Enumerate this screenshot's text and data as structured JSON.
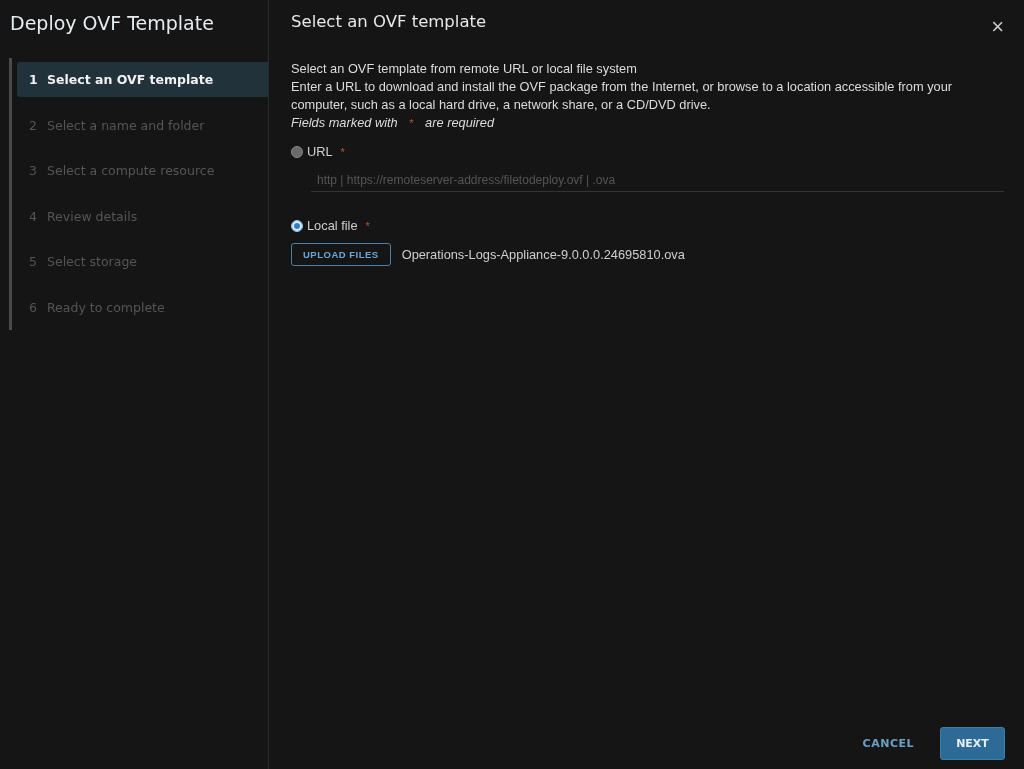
{
  "window": {
    "title": "Deploy OVF Template",
    "close": "×"
  },
  "steps": [
    {
      "number": "1",
      "label": "Select an OVF template",
      "selected": true,
      "disabled": false
    },
    {
      "number": "2",
      "label": "Select a name and folder",
      "selected": false,
      "disabled": true
    },
    {
      "number": "3",
      "label": "Select a compute resource",
      "selected": false,
      "disabled": true
    },
    {
      "number": "4",
      "label": "Review details",
      "selected": false,
      "disabled": true
    },
    {
      "number": "5",
      "label": "Select storage",
      "selected": false,
      "disabled": true
    },
    {
      "number": "6",
      "label": "Ready to complete",
      "selected": false,
      "disabled": true
    }
  ],
  "page": {
    "title": "Select an OVF template",
    "intro": "Select an OVF template from remote URL or local file system",
    "description": "Enter a URL to download and install the OVF package from the Internet, or browse to a location accessible from your computer, such as a local hard drive, a network share, or a CD/DVD drive.",
    "required_note": {
      "before": "Fields marked with",
      "mark": "*",
      "after": "are required"
    }
  },
  "sources": [
    {
      "kind": "url",
      "label": "URL",
      "required_mark": "*",
      "selected": false,
      "placeholder": "http | https://remoteserver-address/filetodeploy.ovf | .ova"
    },
    {
      "kind": "file",
      "label": "Local file",
      "required_mark": "*",
      "selected": true,
      "button": "UPLOAD FILES",
      "file_name": "Operations-Logs-Appliance-9.0.0.0.24695810.ova"
    }
  ],
  "buttons": {
    "cancel": "CANCEL",
    "next": "NEXT"
  }
}
